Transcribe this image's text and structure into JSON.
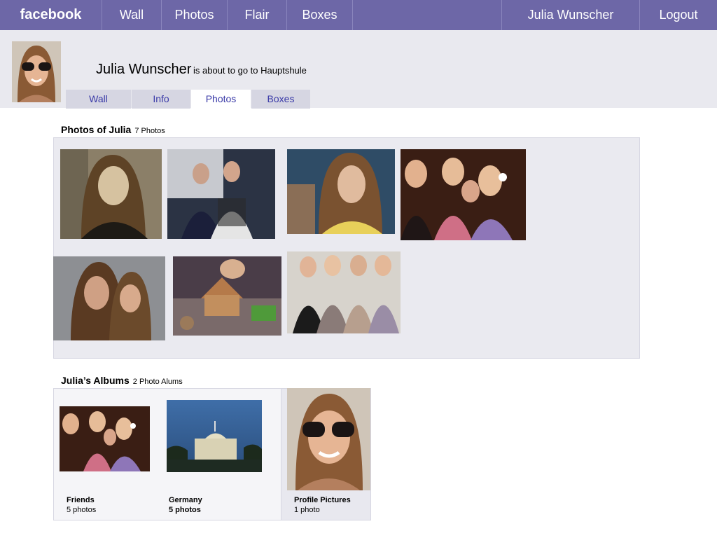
{
  "nav": {
    "logo": "facebook",
    "items": [
      "Wall",
      "Photos",
      "Flair",
      "Boxes"
    ],
    "user": "Julia Wunscher",
    "logout": "Logout"
  },
  "profile": {
    "name": "Julia Wunscher",
    "status": "is about to go to Hauptshule",
    "tabs": [
      {
        "label": "Wall",
        "active": false
      },
      {
        "label": "Info",
        "active": false
      },
      {
        "label": "Photos",
        "active": true
      },
      {
        "label": "Boxes",
        "active": false
      }
    ]
  },
  "photos": {
    "title": "Photos of Julia",
    "count": "7 Photos"
  },
  "albums": {
    "title": "Julia’s Albums",
    "count": "2 Photo Alums",
    "items": [
      {
        "name": "Friends",
        "count": "5 photos"
      },
      {
        "name": "Germany",
        "count": "5 photos"
      },
      {
        "name": "Profile Pictures",
        "count": "1 photo"
      }
    ]
  },
  "colors": {
    "nav_bg": "#6d67a7",
    "header_bg": "#e9e9ef",
    "tab_text": "#3b3ba8",
    "panel_bg": "#eaeaf0"
  }
}
